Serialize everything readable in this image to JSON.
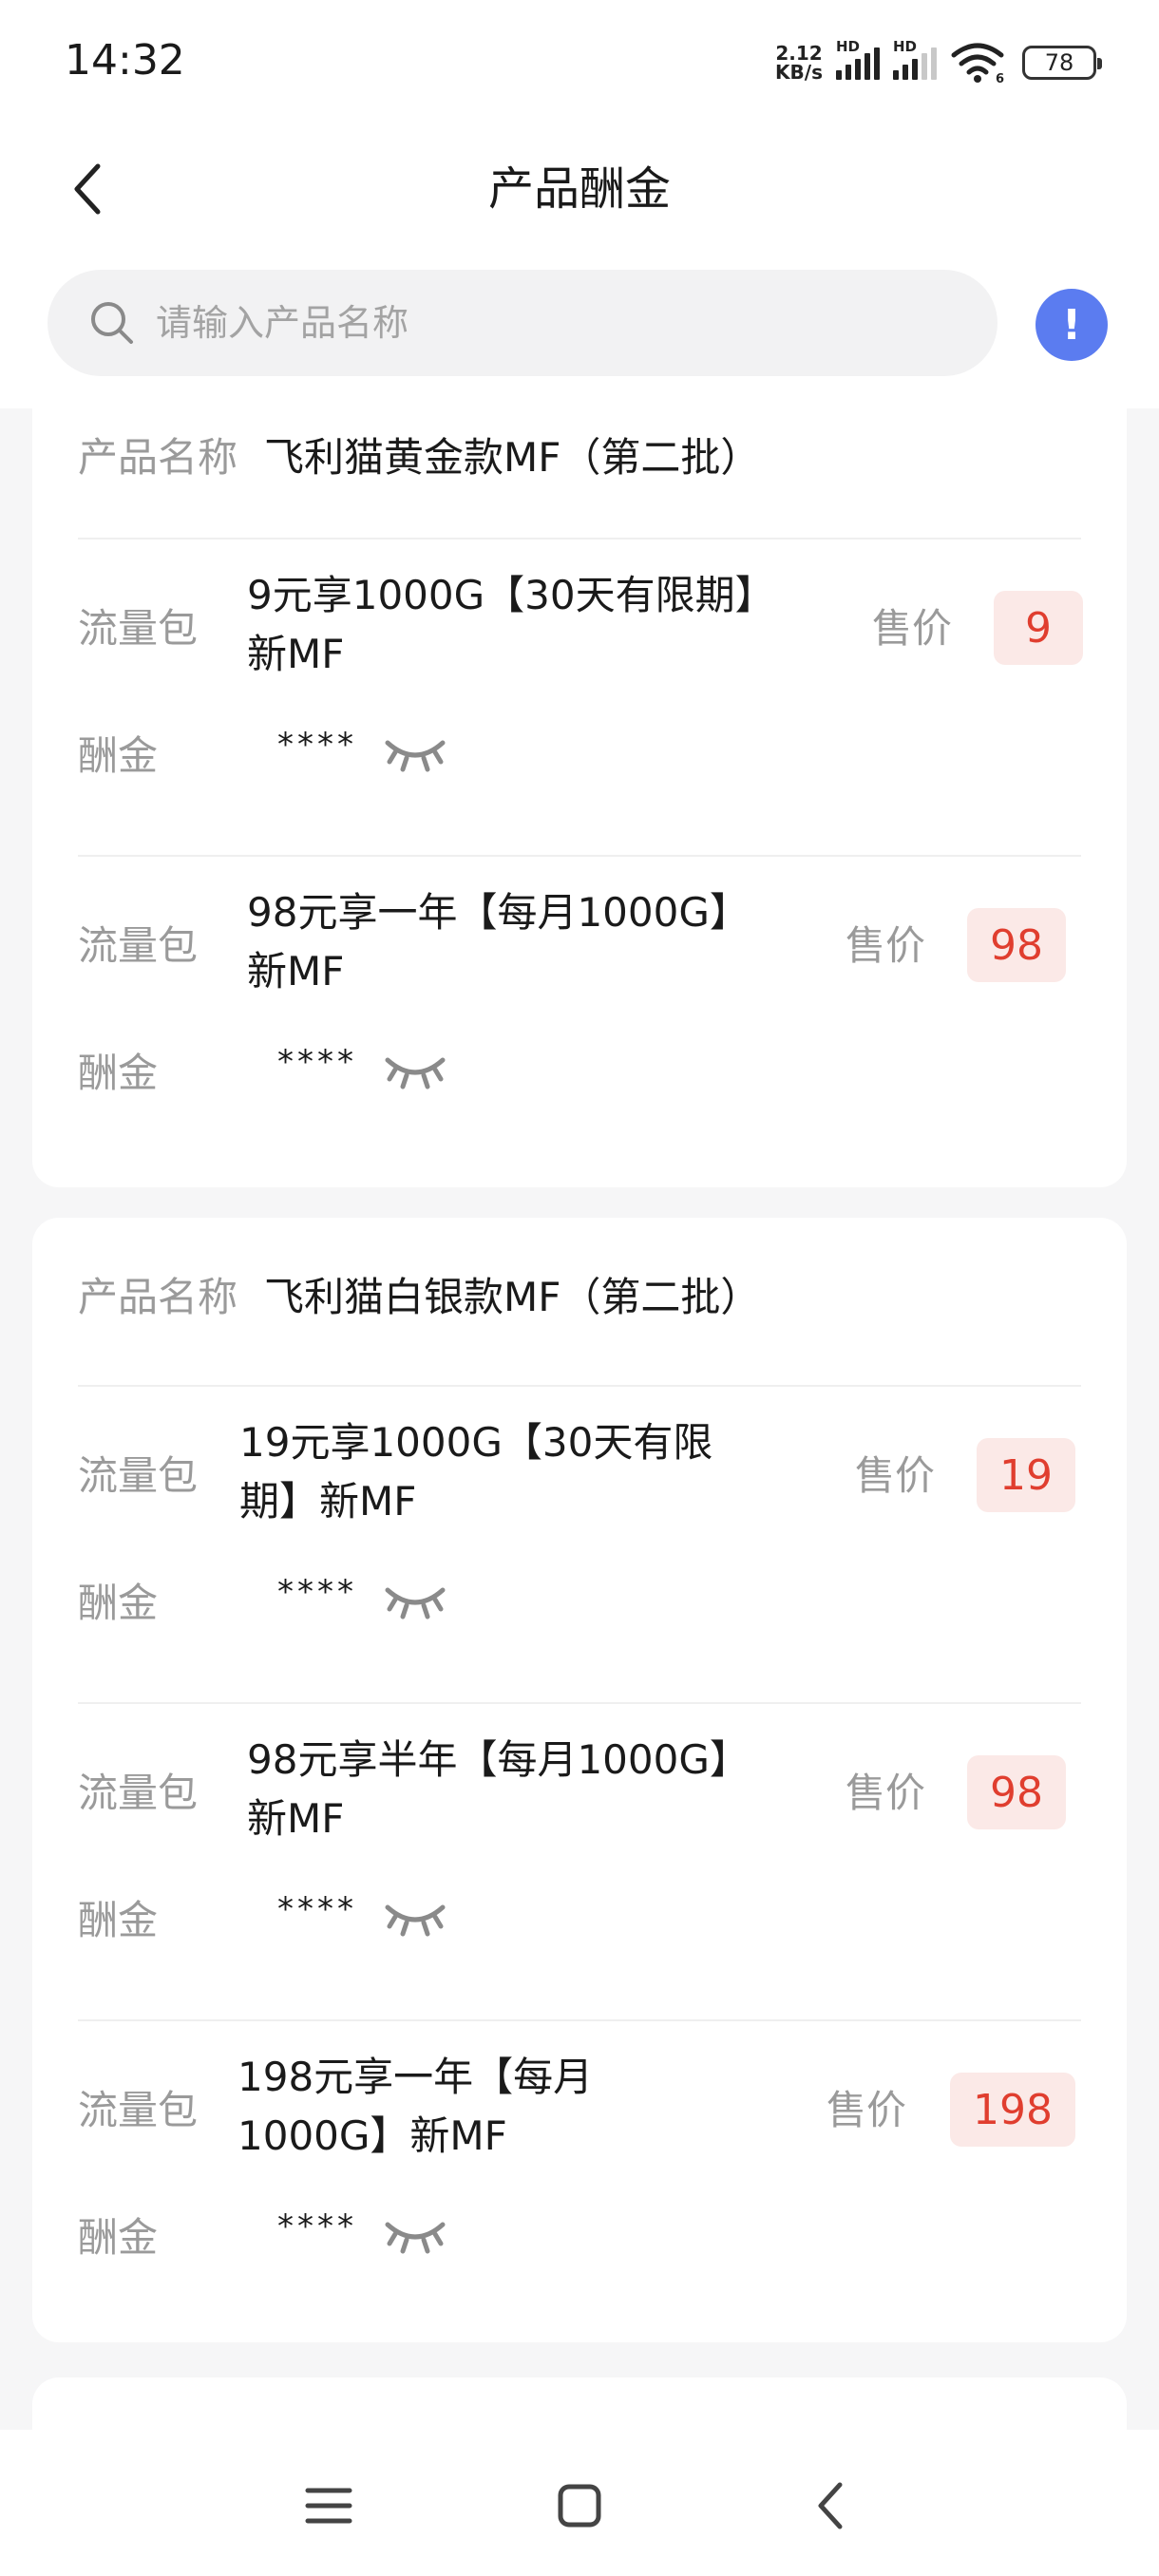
{
  "status": {
    "time": "14:32",
    "speed_value": "2.12",
    "speed_unit": "KB/s",
    "hd": "HD",
    "wifi_sub": "6",
    "battery": "78"
  },
  "header": {
    "title": "产品酬金"
  },
  "search": {
    "placeholder": "请输入产品名称",
    "value": ""
  },
  "labels": {
    "product_name": "产品名称",
    "traffic_pack": "流量包",
    "commission": "酬金",
    "price": "售价",
    "masked": "****"
  },
  "groups": [
    {
      "product_name": "飞利猫黄金款MF（第二批）",
      "items": [
        {
          "pkg_line1": "9元享1000G【30天有限期】",
          "pkg_line2": "新MF",
          "price": "9"
        },
        {
          "pkg_line1": "98元享一年【每月1000G】",
          "pkg_line2": "新MF",
          "price": "98"
        }
      ]
    },
    {
      "product_name": "飞利猫白银款MF（第二批）",
      "items": [
        {
          "pkg_line1": "19元享1000G【30天有限",
          "pkg_line2": "期】新MF",
          "price": "19"
        },
        {
          "pkg_line1": "98元享半年【每月1000G】",
          "pkg_line2": "新MF",
          "price": "98"
        },
        {
          "pkg_line1": "198元享一年【每月",
          "pkg_line2": "1000G】新MF",
          "price": "198"
        }
      ]
    }
  ],
  "icons": {
    "back": "chevron-left-icon",
    "search": "search-icon",
    "info": "exclamation-icon",
    "eye": "eye-closed-icon",
    "menu": "menu-icon",
    "home": "home-square-icon",
    "nav_back": "nav-back-icon"
  },
  "colors": {
    "accent": "#5b7cf0",
    "price_text": "#e03e2f",
    "price_bg": "#fbe9e7"
  }
}
